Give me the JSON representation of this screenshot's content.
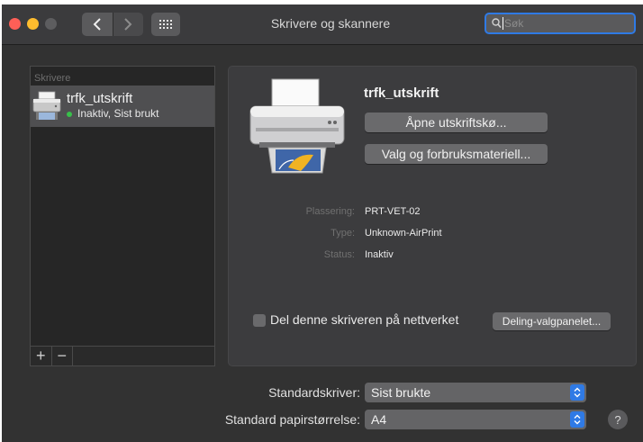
{
  "window": {
    "title": "Skrivere og skannere"
  },
  "toolbar": {
    "back_icon": "chevron-left-icon",
    "forward_icon": "chevron-right-icon",
    "show_all_icon": "grid-icon",
    "search": {
      "value": "",
      "placeholder": "Søk"
    }
  },
  "sidebar": {
    "heading": "Skrivere",
    "printers": [
      {
        "name": "trfk_utskrift",
        "status": "Inaktiv, Sist brukt",
        "selected": true
      }
    ],
    "add_label": "+",
    "remove_label": "−"
  },
  "detail": {
    "printer_name": "trfk_utskrift",
    "open_queue_label": "Åpne utskriftskø...",
    "options_label": "Valg og forbruksmateriell...",
    "info": [
      {
        "label": "Plassering:",
        "value": "PRT-VET-02"
      },
      {
        "label": "Type:",
        "value": "Unknown-AirPrint"
      },
      {
        "label": "Status:",
        "value": "Inaktiv"
      }
    ],
    "share_label": "Del denne skriveren på nettverket",
    "share_checked": false,
    "sharing_prefs_label": "Deling-valgpanelet..."
  },
  "defaults": {
    "printer_label": "Standardskriver:",
    "printer_value": "Sist brukte",
    "paper_label": "Standard papirstørrelse:",
    "paper_value": "A4"
  },
  "help_label": "?",
  "colors": {
    "accent": "#2f7ae5",
    "status_ok": "#38c04a",
    "close": "#fe5f57",
    "minimize": "#febc2e"
  }
}
